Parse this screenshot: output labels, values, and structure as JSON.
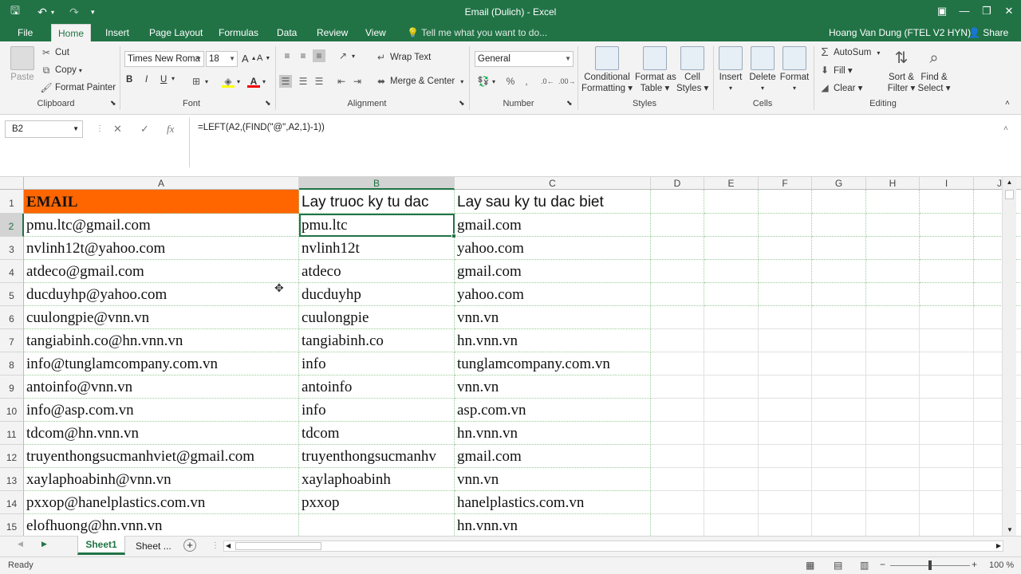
{
  "window": {
    "title": "Email (Dulich) - Excel",
    "user": "Hoang Van Dung (FTEL V2 HYN)",
    "share": "Share"
  },
  "tabs": [
    "File",
    "Home",
    "Insert",
    "Page Layout",
    "Formulas",
    "Data",
    "Review",
    "View"
  ],
  "tell_me": "Tell me what you want to do...",
  "ribbon": {
    "clipboard": {
      "paste": "Paste",
      "cut": "Cut",
      "copy": "Copy",
      "format_painter": "Format Painter",
      "label": "Clipboard"
    },
    "font": {
      "name": "Times New Roma",
      "size": "18",
      "bold": "B",
      "italic": "I",
      "underline": "U",
      "label": "Font"
    },
    "alignment": {
      "wrap": "Wrap Text",
      "merge": "Merge & Center",
      "label": "Alignment"
    },
    "number": {
      "format": "General",
      "label": "Number"
    },
    "styles": {
      "conditional": "Conditional",
      "conditional2": "Formatting ▾",
      "format_as": "Format as",
      "format_as2": "Table ▾",
      "cell": "Cell",
      "cell2": "Styles ▾",
      "label": "Styles"
    },
    "cells": {
      "insert": "Insert",
      "delete": "Delete",
      "format": "Format",
      "label": "Cells"
    },
    "editing": {
      "autosum": "AutoSum",
      "fill": "Fill ▾",
      "clear": "Clear ▾",
      "sort": "Sort &",
      "sort2": "Filter ▾",
      "find": "Find &",
      "find2": "Select ▾",
      "label": "Editing"
    }
  },
  "formula_bar": {
    "name_box": "B2",
    "formula": "=LEFT(A2,(FIND(\"@\",A2,1)-1))"
  },
  "columns": [
    "A",
    "B",
    "C",
    "D",
    "E",
    "F",
    "G",
    "H",
    "I",
    "J"
  ],
  "header_row": {
    "a": "EMAIL",
    "b": "Lay truoc ky tu dac",
    "c": "Lay sau ky tu dac biet"
  },
  "rows": [
    {
      "n": "2",
      "a": "pmu.ltc@gmail.com",
      "b": "pmu.ltc",
      "c": "gmail.com"
    },
    {
      "n": "3",
      "a": "nvlinh12t@yahoo.com",
      "b": "nvlinh12t",
      "c": "yahoo.com"
    },
    {
      "n": "4",
      "a": "atdeco@gmail.com",
      "b": "atdeco",
      "c": "gmail.com"
    },
    {
      "n": "5",
      "a": "ducduyhp@yahoo.com",
      "b": "ducduyhp",
      "c": "yahoo.com"
    },
    {
      "n": "6",
      "a": "cuulongpie@vnn.vn",
      "b": "cuulongpie",
      "c": "vnn.vn"
    },
    {
      "n": "7",
      "a": "tangiabinh.co@hn.vnn.vn",
      "b": "tangiabinh.co",
      "c": "hn.vnn.vn"
    },
    {
      "n": "8",
      "a": "info@tunglamcompany.com.vn",
      "b": "info",
      "c": "tunglamcompany.com.vn"
    },
    {
      "n": "9",
      "a": "antoinfo@vnn.vn",
      "b": "antoinfo",
      "c": "vnn.vn"
    },
    {
      "n": "10",
      "a": "info@asp.com.vn",
      "b": "info",
      "c": "asp.com.vn"
    },
    {
      "n": "11",
      "a": "tdcom@hn.vnn.vn",
      "b": "tdcom",
      "c": "hn.vnn.vn"
    },
    {
      "n": "12",
      "a": "truyenthongsucmanhviet@gmail.com",
      "b": "truyenthongsucmanhv",
      "c": "gmail.com"
    },
    {
      "n": "13",
      "a": "xaylaphoabinh@vnn.vn",
      "b": "xaylaphoabinh",
      "c": "vnn.vn"
    },
    {
      "n": "14",
      "a": "pxxop@hanelplastics.com.vn",
      "b": "pxxop",
      "c": "hanelplastics.com.vn"
    },
    {
      "n": "15",
      "a": "elofhuong@hn.vnn.vn",
      "b": "",
      "c": "hn.vnn.vn"
    }
  ],
  "sheets": {
    "active": "Sheet1",
    "other": "Sheet ..."
  },
  "status": {
    "ready": "Ready",
    "zoom": "100 %"
  }
}
